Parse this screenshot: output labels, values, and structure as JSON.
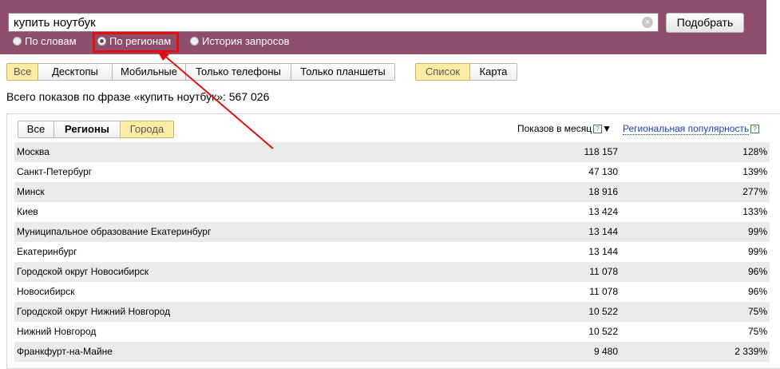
{
  "search": {
    "query": "купить ноутбук",
    "submit_label": "Подобрать"
  },
  "modes": [
    {
      "label": "По словам",
      "selected": false
    },
    {
      "label": "По регионам",
      "selected": true
    },
    {
      "label": "История запросов",
      "selected": false
    }
  ],
  "device_tabs": [
    "Все",
    "Десктопы",
    "Мобильные",
    "Только телефоны",
    "Только планшеты"
  ],
  "device_active": "Все",
  "view_tabs": [
    "Список",
    "Карта"
  ],
  "view_active": "Список",
  "total_text": "Всего показов по фразе «купить ноутбук»: 567 026",
  "region_tabs": [
    "Все",
    "Регионы",
    "Города"
  ],
  "region_active": "Города",
  "columns": {
    "shows": "Показов в месяц",
    "sort_icon": "▼",
    "popularity": "Региональная популярность",
    "help": "?"
  },
  "rows": [
    {
      "region": "Москва",
      "shows": "118 157",
      "popularity": "128%"
    },
    {
      "region": "Санкт-Петербург",
      "shows": "47 130",
      "popularity": "139%"
    },
    {
      "region": "Минск",
      "shows": "18 916",
      "popularity": "277%"
    },
    {
      "region": "Киев",
      "shows": "13 424",
      "popularity": "133%"
    },
    {
      "region": "Муниципальное образование Екатеринбург",
      "shows": "13 144",
      "popularity": "99%"
    },
    {
      "region": "Екатеринбург",
      "shows": "13 144",
      "popularity": "99%"
    },
    {
      "region": "Городской округ Новосибирск",
      "shows": "11 078",
      "popularity": "96%"
    },
    {
      "region": "Новосибирск",
      "shows": "11 078",
      "popularity": "96%"
    },
    {
      "region": "Городской округ Нижний Новгород",
      "shows": "10 522",
      "popularity": "75%"
    },
    {
      "region": "Нижний Новгород",
      "shows": "10 522",
      "popularity": "75%"
    },
    {
      "region": "Франкфурт-на-Майне",
      "shows": "9 480",
      "popularity": "2 339%"
    }
  ],
  "colors": {
    "header": "#8d4d6b",
    "annotation": "#e01010",
    "active_tab": "#fdeda4"
  }
}
